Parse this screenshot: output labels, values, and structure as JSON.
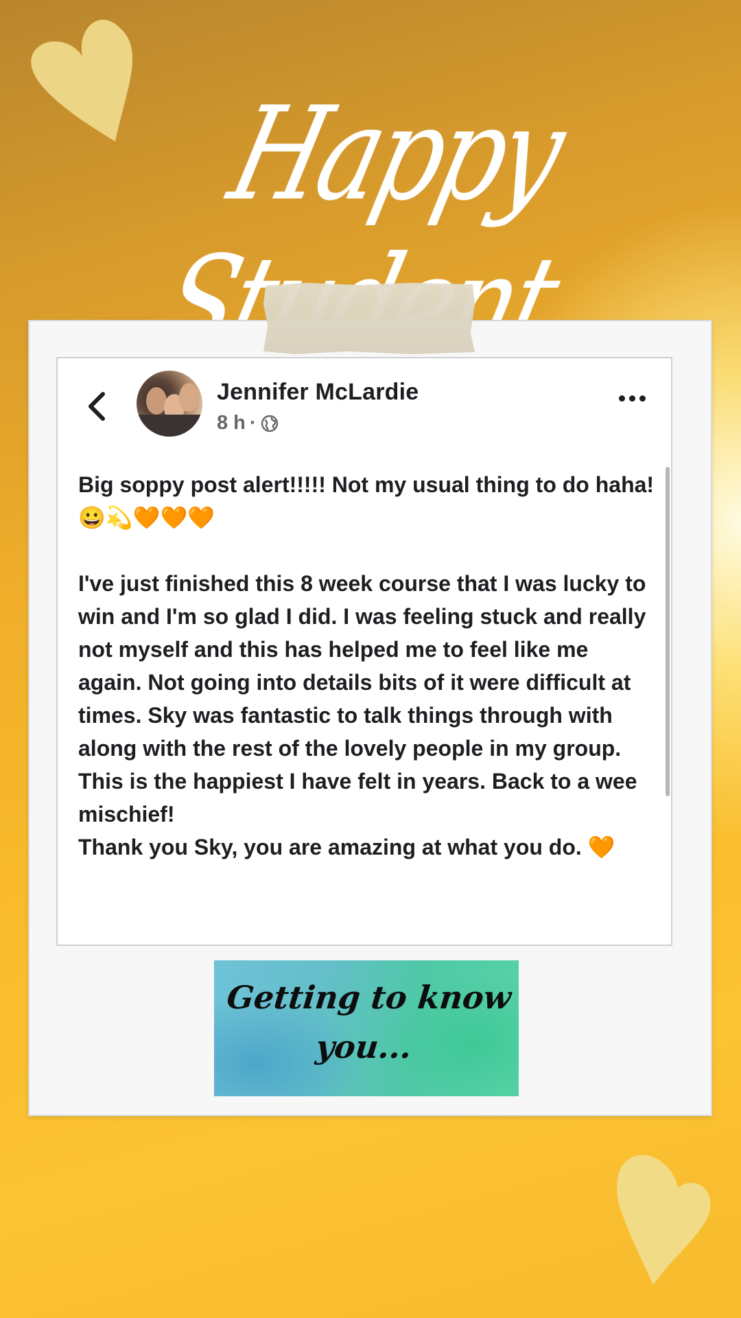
{
  "page": {
    "title": "Happy Student"
  },
  "post": {
    "author": "Jennifer McLardie",
    "time": "8 h",
    "separator": "·",
    "visibility_icon": "globe-icon",
    "back_icon": "chevron-left-icon",
    "more_icon": "more-dots-icon",
    "body": "Big soppy post alert!!!!! Not my usual thing to do haha! 😀💫🧡🧡🧡\n\nI've just finished this 8 week course that I was lucky to win and I'm so glad I did. I was feeling stuck and really not myself and this has helped me to feel like me again. Not going into details bits of it were difficult at times. Sky was fantastic to talk things through with along with the rest of the lovely people in my group. This is the happiest I have felt in years. Back to a wee mischief!\nThank you Sky, you are amazing at what you do. 🧡"
  },
  "banner": {
    "line1": "Getting to know",
    "line2": "you..."
  },
  "colors": {
    "heart": "#f0dc8a",
    "text_dark": "#1c1e21",
    "meta_grey": "#65676b"
  }
}
